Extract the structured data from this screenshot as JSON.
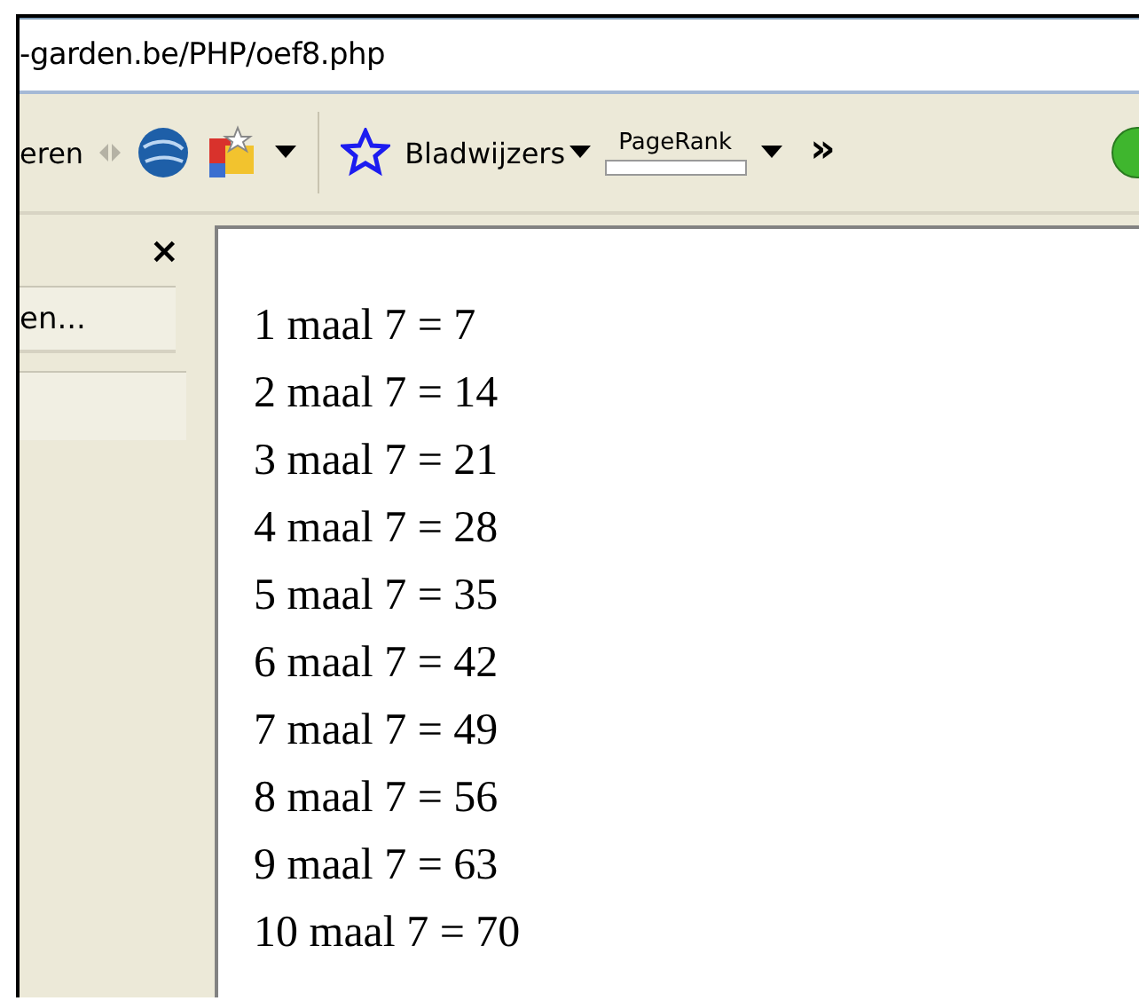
{
  "address_bar": {
    "url": "-garden.be/PHP/oef8.php"
  },
  "toolbar": {
    "cut_label": "eren",
    "bookmarks": "Bladwijzers",
    "pagerank": {
      "label": "PageRank",
      "level": 0
    },
    "more": "»"
  },
  "sidebar": {
    "close": "×",
    "button": "en..."
  },
  "content": {
    "lines": [
      "1 maal 7 = 7",
      "2 maal 7 = 14",
      "3 maal 7 = 21",
      "4 maal 7 = 28",
      "5 maal 7 = 35",
      "6 maal 7 = 42",
      "7 maal 7 = 49",
      "8 maal 7 = 56",
      "9 maal 7 = 63",
      "10 maal 7 = 70"
    ]
  }
}
